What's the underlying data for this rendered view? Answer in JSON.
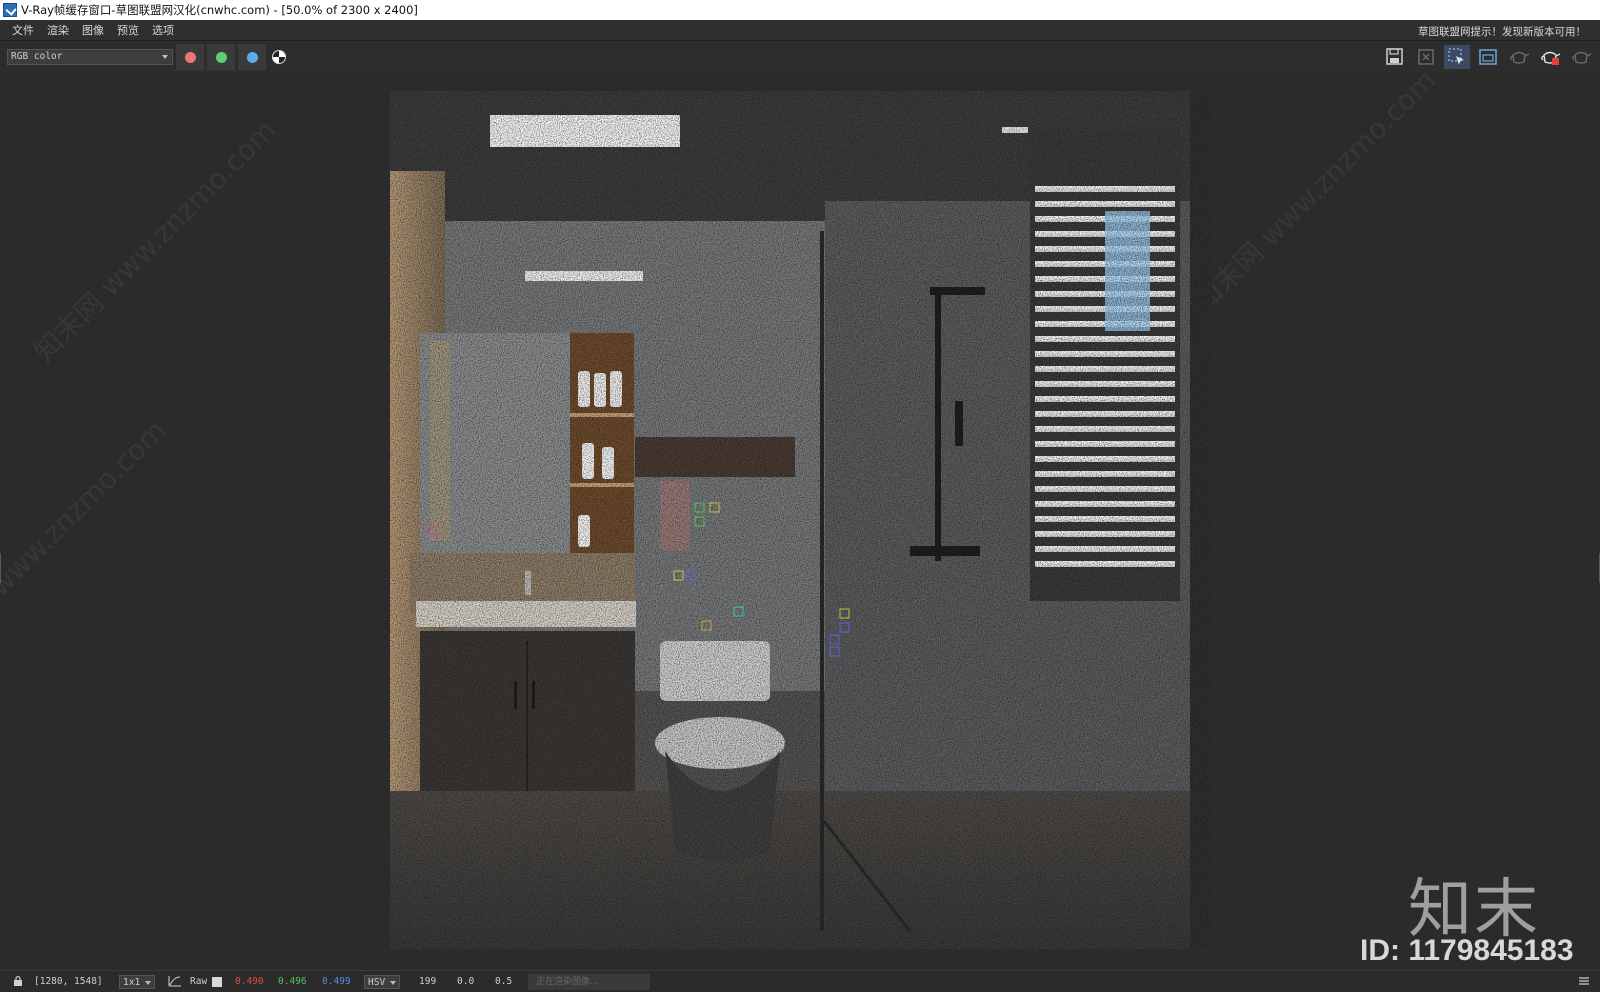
{
  "window": {
    "title": "V-Ray帧缓存窗口-草图联盟网汉化(cnwhc.com) - [50.0% of 2300 x 2400]"
  },
  "menu": {
    "items": [
      {
        "label": "文件"
      },
      {
        "label": "渲染"
      },
      {
        "label": "图像"
      },
      {
        "label": "预览"
      },
      {
        "label": "选项"
      }
    ],
    "notice": "草图联盟网提示！发现新版本可用！"
  },
  "toolbar": {
    "channel_value": "RGB color",
    "channel_colors": {
      "red": "#e8757a",
      "green": "#5fcf6e",
      "blue": "#5aaee8"
    },
    "right_icons": [
      "save-icon",
      "clear-icon",
      "region-select-icon",
      "region-render-icon",
      "teapot-icon",
      "teapot-render-icon",
      "teapot-stop-icon"
    ]
  },
  "status": {
    "coords": "[1280, 1548]",
    "zoom_value": "1x1",
    "mode_label": "Raw",
    "r": "0.490",
    "g": "0.496",
    "b": "0.499",
    "space_value": "HSV",
    "h": "199",
    "s": "0.0",
    "v": "0.5",
    "progress_text": "正在渲染图像..."
  },
  "colors": {
    "r_value": "#e04a4a",
    "g_value": "#4fc25a",
    "b_value": "#4f8fe0"
  },
  "watermark": {
    "diagonal": "知末网 www.znzmo.com",
    "brand": "知末",
    "id": "ID: 1179845183"
  }
}
